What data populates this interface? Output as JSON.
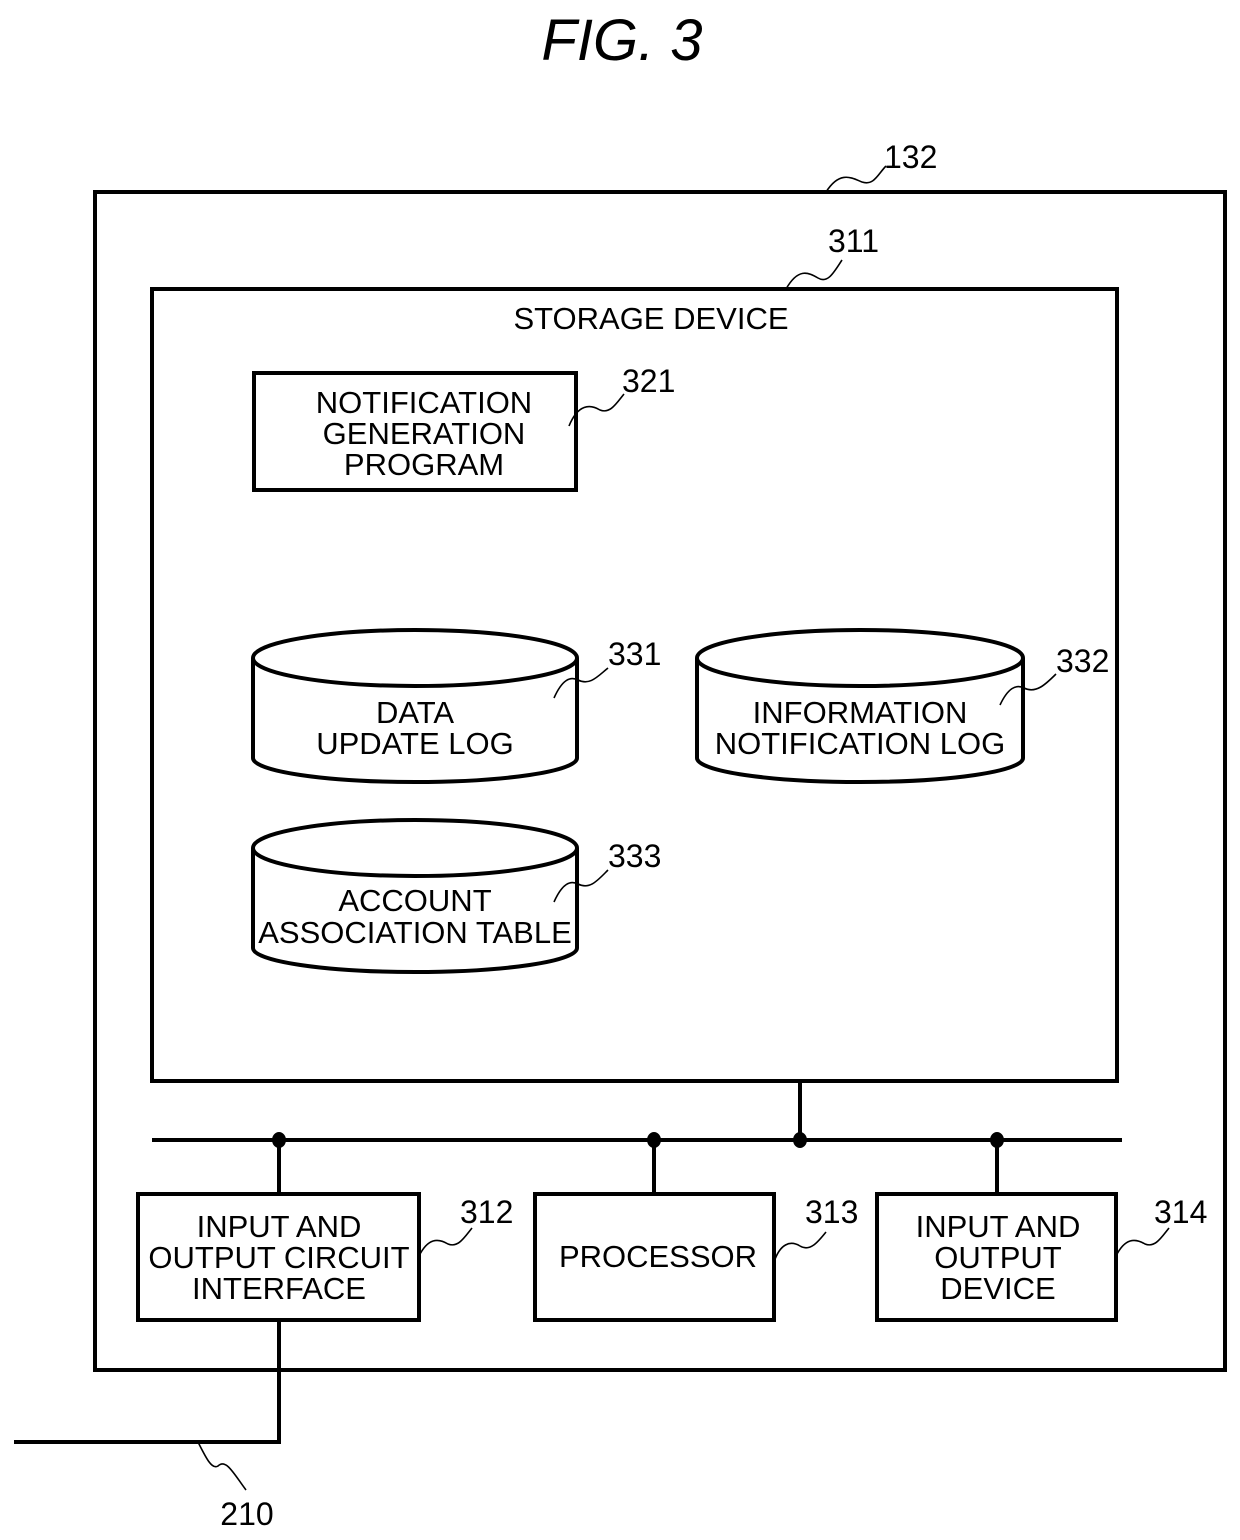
{
  "figure": {
    "title": "FIG. 3"
  },
  "refs": {
    "device": "132",
    "storage": "311",
    "io_interface": "312",
    "processor": "313",
    "io_device": "314",
    "program": "321",
    "data_log": "331",
    "info_log": "332",
    "account_table": "333",
    "network": "210"
  },
  "storage_device": {
    "label": "STORAGE DEVICE"
  },
  "program": {
    "lines": [
      "NOTIFICATION",
      "GENERATION",
      "PROGRAM"
    ]
  },
  "databases": {
    "data_update_log": {
      "lines": [
        "DATA",
        "UPDATE LOG"
      ]
    },
    "info_notification_log": {
      "lines": [
        "INFORMATION",
        "NOTIFICATION LOG"
      ]
    },
    "account_association_table": {
      "lines": [
        "ACCOUNT",
        "ASSOCIATION TABLE"
      ]
    }
  },
  "components": {
    "io_interface": {
      "lines": [
        "INPUT AND",
        "OUTPUT CIRCUIT",
        "INTERFACE"
      ]
    },
    "processor": {
      "lines": [
        "PROCESSOR"
      ]
    },
    "io_device": {
      "lines": [
        "INPUT AND",
        "OUTPUT",
        "DEVICE"
      ]
    }
  }
}
